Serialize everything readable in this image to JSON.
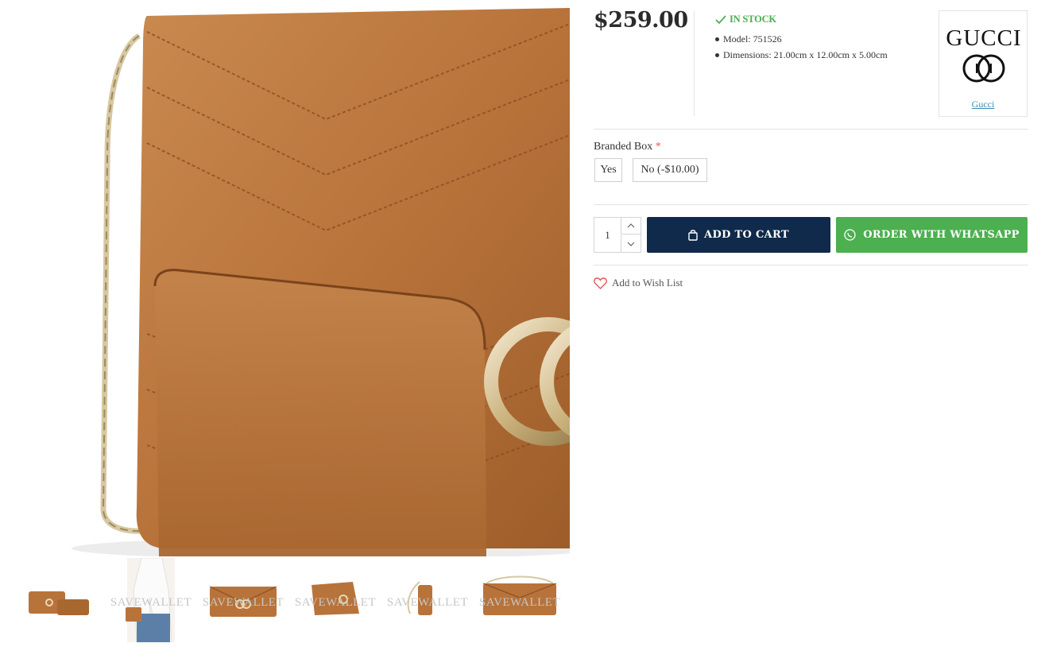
{
  "product": {
    "price": "$259.00",
    "stock_status": "IN STOCK",
    "specs": [
      {
        "text": "Model: 751526"
      },
      {
        "text": "Dimensions: 21.00cm x 12.00cm x 5.00cm"
      }
    ]
  },
  "brand": {
    "logo_text": "GUCCI",
    "link_label": "Gucci"
  },
  "options": {
    "label": "Branded Box",
    "required_mark": "*",
    "choices": [
      "Yes",
      "No (-$10.00)"
    ]
  },
  "cart": {
    "quantity": "1",
    "add_to_cart_label": "ADD TO CART",
    "whatsapp_label": "ORDER WITH WHATSAPP"
  },
  "wishlist": {
    "label": "Add to Wish List"
  },
  "gallery": {
    "watermark": "SAVEWALLET",
    "thumbnail_count": 6
  },
  "colors": {
    "leather": "#b8733a",
    "cart_button": "#0f2a4a",
    "whatsapp_button": "#4caf50",
    "stock_green": "#4caf50",
    "link_blue": "#3b8fb1",
    "required_red": "#e25656"
  }
}
